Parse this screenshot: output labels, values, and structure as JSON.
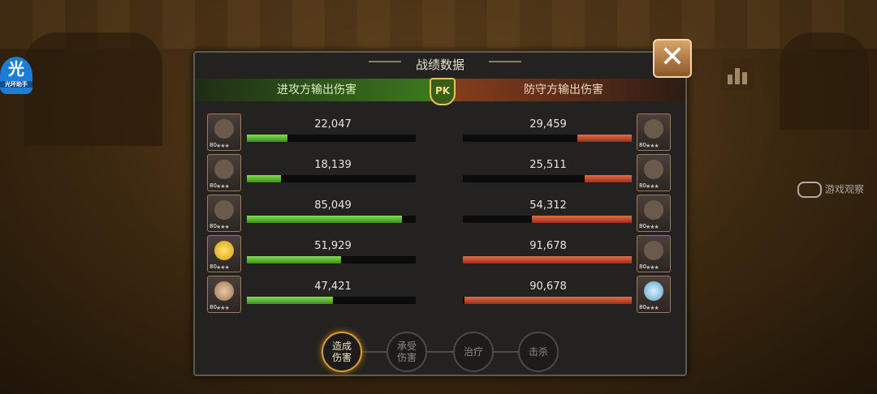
{
  "panel": {
    "title": "战绩数据",
    "attacker_header": "进攻方输出伤害",
    "defender_header": "防守方输出伤害",
    "pk_label": "PK"
  },
  "background": {
    "logo_char": "光",
    "logo_caption": "光环助手",
    "watermark_text": "游戏观察"
  },
  "icons": {
    "close": "close-icon",
    "stats": "bar-chart-icon"
  },
  "attackers": [
    {
      "value": "22,047",
      "ratio": 0.24,
      "level": "80",
      "stars": "★★★",
      "variant": "dark"
    },
    {
      "value": "18,139",
      "ratio": 0.2,
      "level": "80",
      "stars": "★★★",
      "variant": "dark"
    },
    {
      "value": "85,049",
      "ratio": 0.92,
      "level": "80",
      "stars": "★★★",
      "variant": "dark"
    },
    {
      "value": "51,929",
      "ratio": 0.56,
      "level": "80",
      "stars": "★★★",
      "variant": "gold"
    },
    {
      "value": "47,421",
      "ratio": 0.51,
      "level": "80",
      "stars": "★★★",
      "variant": "pink"
    }
  ],
  "defenders": [
    {
      "value": "29,459",
      "ratio": 0.32,
      "level": "80",
      "stars": "★★★",
      "variant": "dark"
    },
    {
      "value": "25,511",
      "ratio": 0.28,
      "level": "80",
      "stars": "★★★",
      "variant": "dark"
    },
    {
      "value": "54,312",
      "ratio": 0.59,
      "level": "80",
      "stars": "★★★",
      "variant": "dark"
    },
    {
      "value": "91,678",
      "ratio": 1.0,
      "level": "80",
      "stars": "★★★",
      "variant": "dark"
    },
    {
      "value": "90,678",
      "ratio": 0.99,
      "level": "80",
      "stars": "★★★",
      "variant": "teal"
    }
  ],
  "tabs": [
    {
      "label": "造成\n伤害",
      "active": true
    },
    {
      "label": "承受\n伤害",
      "active": false
    },
    {
      "label": "治疗",
      "active": false
    },
    {
      "label": "击杀",
      "active": false
    }
  ],
  "colors": {
    "attacker_bar": "#5cb832",
    "defender_bar": "#c9462b",
    "active_tab": "#d69d3c"
  }
}
